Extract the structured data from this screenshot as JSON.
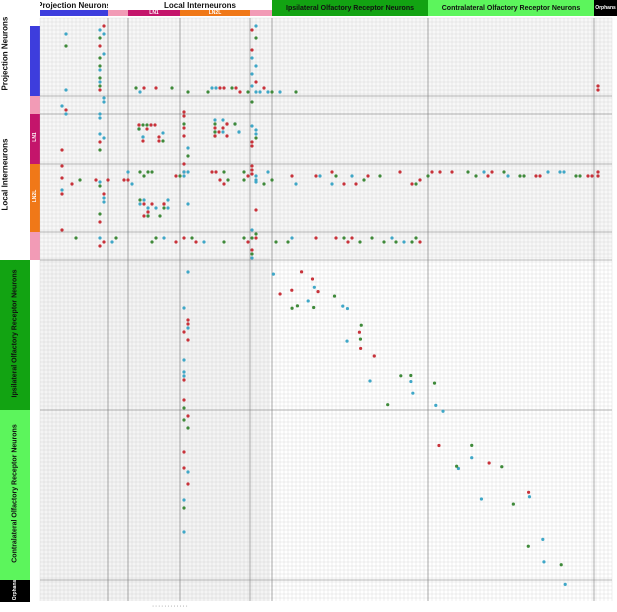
{
  "header": {
    "groups": [
      {
        "label": "Projection Neurons",
        "color": "#3d3ddd"
      },
      {
        "label": "Local Interneurons",
        "color": "#e94f8a"
      },
      {
        "label": "Ipsilateral Olfactory Receptor Neurons",
        "color": "#12a312"
      },
      {
        "label": "Contralateral Olfactory Receptor Neurons",
        "color": "#5cf55c"
      },
      {
        "label": "Orphans",
        "color": "#000000"
      }
    ],
    "subgroups": [
      {
        "label": "LN1",
        "color": "#c4156b"
      },
      {
        "label": "LN2L",
        "color": "#f07818"
      }
    ]
  },
  "sidebar": {
    "groups": [
      {
        "label": "Projection Neurons"
      },
      {
        "label": "Local Interneurons"
      },
      {
        "label": "Ipsilateral Olfactory Receptor Neurons"
      },
      {
        "label": "Contralateral Olfactory Receptor Neurons"
      },
      {
        "label": "Orphans"
      }
    ],
    "subgroups": [
      {
        "label": "LN1"
      },
      {
        "label": "LN2L"
      }
    ]
  },
  "colors": {
    "dot_red": "#c8323a",
    "dot_cyan": "#3fa7c7",
    "dot_green": "#3f8a3a",
    "grid": "#bfbfbf",
    "pn_blue": "#3d3ddd",
    "pn_dark": "#1c1c9c",
    "ln1": "#c4156b",
    "ln2": "#f07818",
    "ln_pink": "#f29bb6",
    "ipsi": "#12a312",
    "contra": "#5cf55c",
    "orphan": "#000000"
  },
  "footer": {
    "scale_label": "· · · · · · · · · · · ·"
  }
}
